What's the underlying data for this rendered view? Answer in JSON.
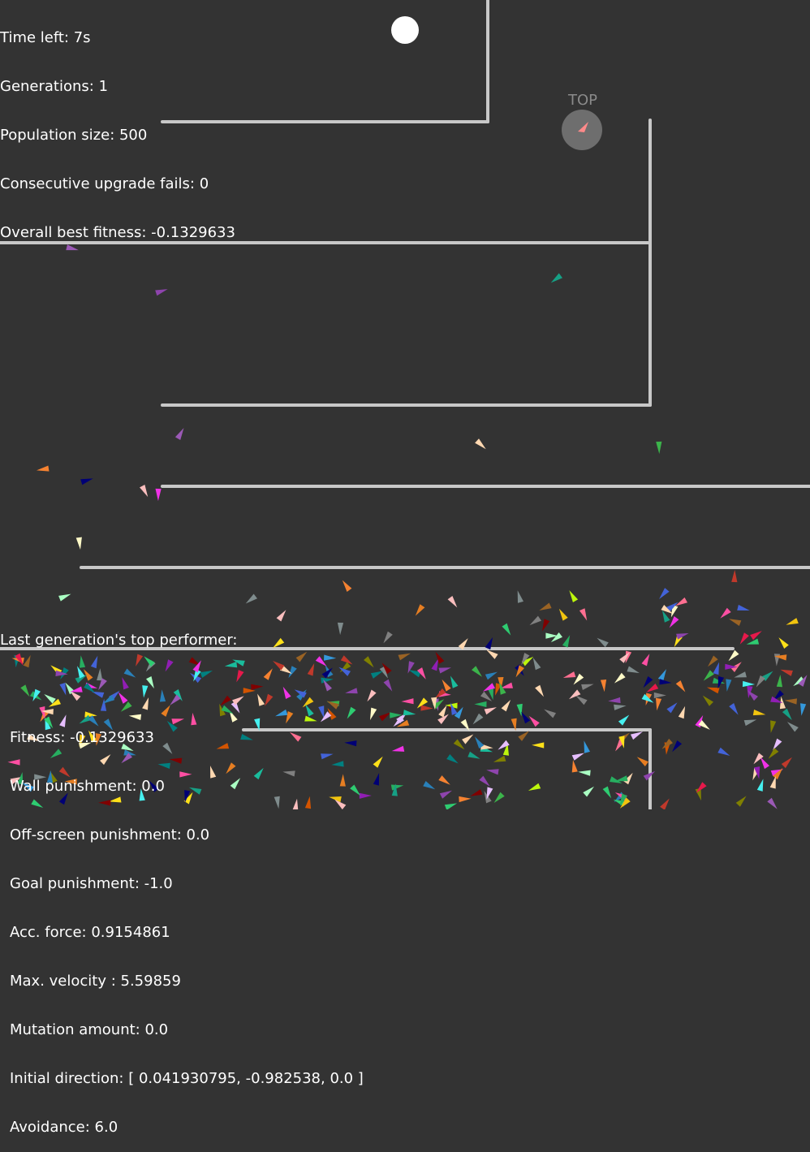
{
  "hud": {
    "time_left": "Time left: 7s",
    "generations": "Generations: 1",
    "population": "Population size: 500",
    "upgrade_fails": "Consecutive upgrade fails: 0",
    "best_fitness": "Overall best fitness: -0.1329633"
  },
  "top_marker": {
    "label": "TOP"
  },
  "report": {
    "heading": "Last generation's top performer:",
    "fitness": "Fitness: -0.1329633",
    "wall_punishment": "Wall punishment: 0.0",
    "offscreen_punishment": "Off-screen punishment: 0.0",
    "goal_punishment": "Goal punishment: -1.0",
    "acc_force": "Acc. force: 0.9154861",
    "max_velocity": "Max. velocity : 5.59859",
    "mutation_amount": "Mutation amount: 0.0",
    "initial_direction": "Initial direction: [ 0.041930795, -0.982538, 0.0 ]",
    "avoidance": "Avoidance: 6.0"
  },
  "colors": {
    "background": "#333333",
    "wall": "#c8c8c8",
    "goal": "#ffffff",
    "top_marker_fill": "#6e6e6e",
    "top_marker_arrow": "#ff8a8a",
    "text": "#ffffff"
  }
}
